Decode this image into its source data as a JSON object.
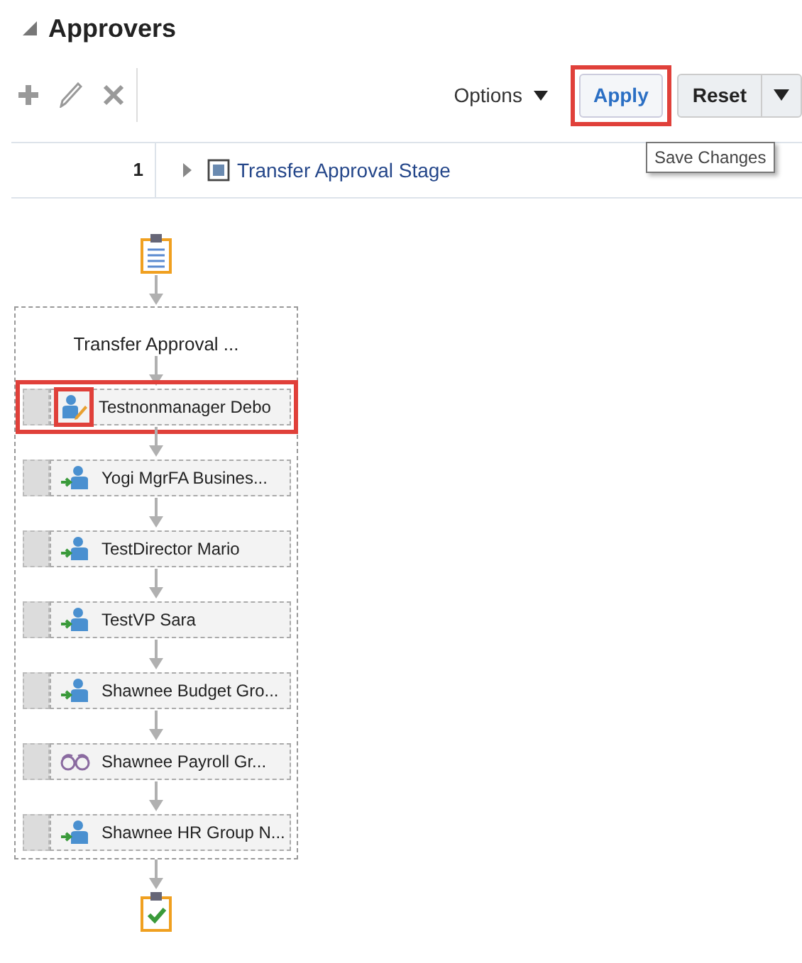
{
  "section": {
    "title": "Approvers",
    "expanded": true
  },
  "toolbar": {
    "options_label": "Options",
    "apply": {
      "label": "Apply",
      "highlighted": true
    },
    "reset": {
      "label": "Reset"
    },
    "tooltip": "Save Changes"
  },
  "table_row": {
    "number": "1",
    "expanded": false,
    "link": "Transfer Approval Stage"
  },
  "flow": {
    "stage_title": "Transfer Approval ...",
    "participants": [
      {
        "name": "Testnonmanager Debo",
        "kind": "edit",
        "highlighted": true
      },
      {
        "name": "Yogi MgrFA Busines...",
        "kind": "assign",
        "highlighted": false
      },
      {
        "name": "TestDirector Mario",
        "kind": "assign",
        "highlighted": false
      },
      {
        "name": "TestVP Sara",
        "kind": "assign",
        "highlighted": false
      },
      {
        "name": "Shawnee Budget Gro...",
        "kind": "assign",
        "highlighted": false
      },
      {
        "name": "Shawnee Payroll Gr...",
        "kind": "fyi",
        "highlighted": false
      },
      {
        "name": "Shawnee HR Group N...",
        "kind": "assign",
        "highlighted": false
      }
    ]
  }
}
